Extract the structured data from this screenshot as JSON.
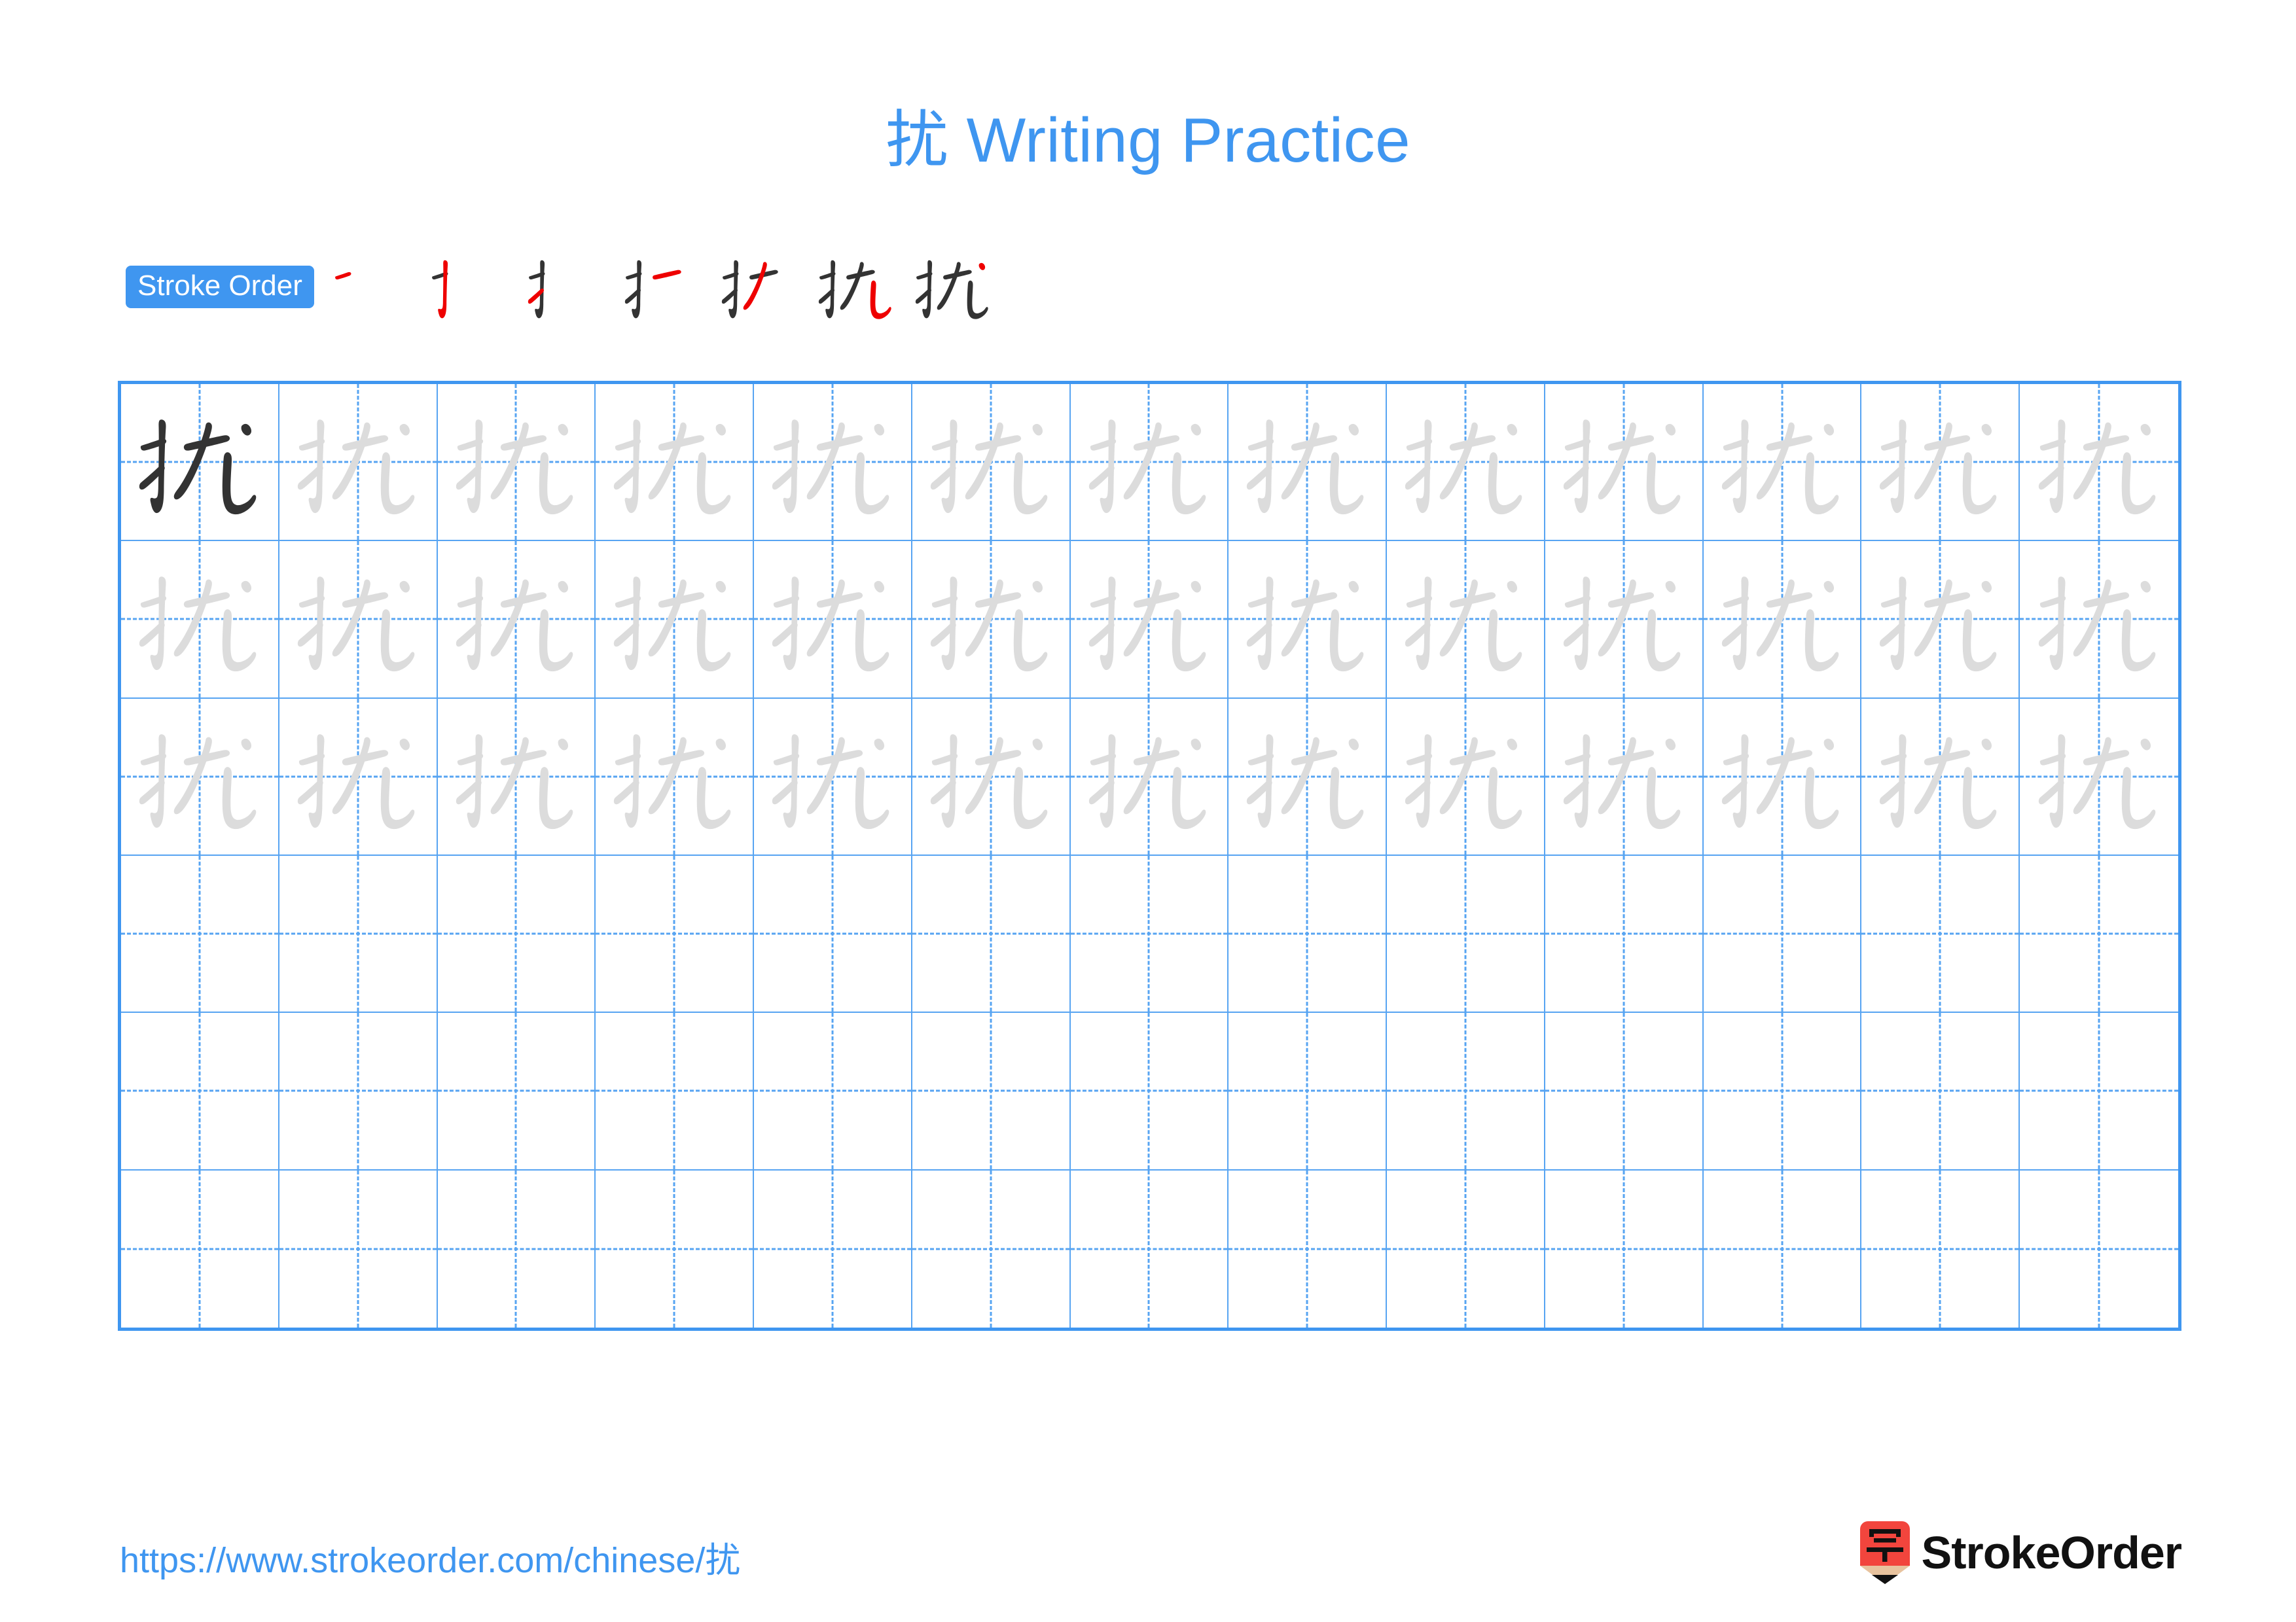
{
  "character": "扰",
  "title": "扰 Writing Practice",
  "colors": {
    "accent_blue": "#3f96f0",
    "grid_line_blue": "#57a4f2",
    "traced_char_gray": "#dcdcdc",
    "model_char_dark": "#333333",
    "new_stroke_red": "#ee0000",
    "logo_red": "#f2453d",
    "logo_tan": "#e8c39e"
  },
  "stroke_order": {
    "badge_label": "Stroke Order",
    "stroke_count": 7,
    "steps": [
      {
        "index": 1,
        "name": "stroke-step-1",
        "description": "横 (heng) short rising stroke"
      },
      {
        "index": 2,
        "name": "stroke-step-2",
        "description": "竖钩 (shu gou) vertical with hook"
      },
      {
        "index": 3,
        "name": "stroke-step-3",
        "description": "提 (ti) upward flick"
      },
      {
        "index": 4,
        "name": "stroke-step-4",
        "description": "横 (heng) horizontal of 尤"
      },
      {
        "index": 5,
        "name": "stroke-step-5",
        "description": "撇 (pie) left falling stroke"
      },
      {
        "index": 6,
        "name": "stroke-step-6",
        "description": "竖弯钩 (shu wan gou) bent vertical with hook"
      },
      {
        "index": 7,
        "name": "stroke-step-7",
        "description": "点 (dian) dot, completes 扰"
      }
    ]
  },
  "grid": {
    "columns": 13,
    "rows": 6,
    "model_cell": {
      "row": 1,
      "column": 1,
      "style": "dark"
    },
    "traced_rows": [
      1,
      2,
      3
    ],
    "blank_rows": [
      4,
      5,
      6
    ]
  },
  "footer": {
    "url": "https://www.strokeorder.com/chinese/扰",
    "brand_name": "StrokeOrder",
    "logo_glyph": "字"
  }
}
